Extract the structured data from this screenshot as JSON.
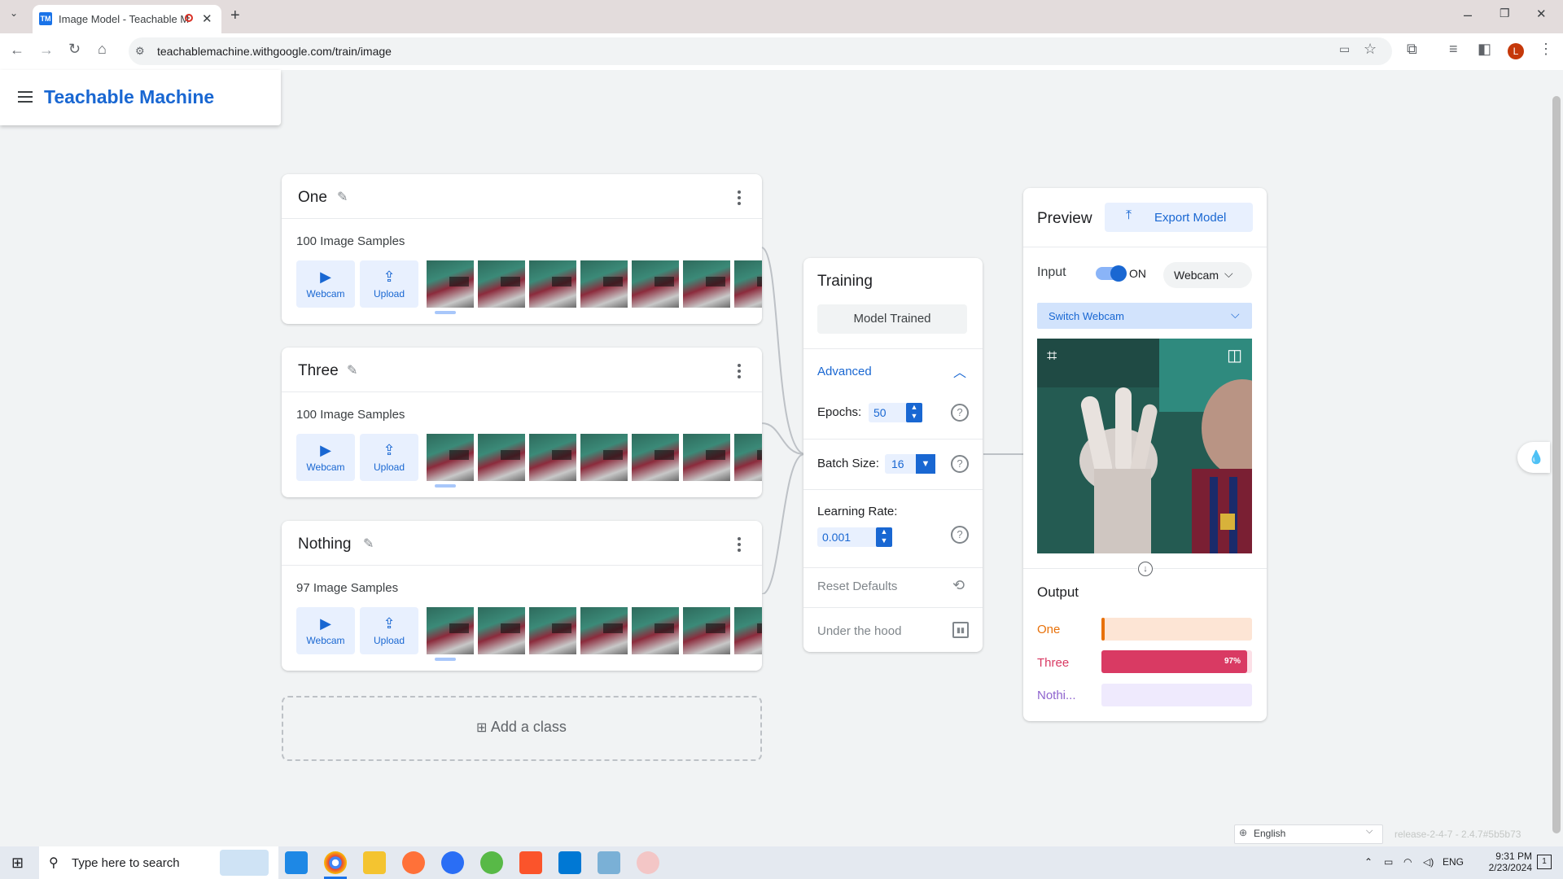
{
  "browser": {
    "tab_title": "Image Model - Teachable M",
    "tab_favicon": "TM",
    "url": "teachablemachine.withgoogle.com/train/image",
    "profile_initial": "L"
  },
  "app": {
    "brand": "Teachable Machine"
  },
  "classes": [
    {
      "name": "One",
      "samples": "100 Image Samples",
      "webcam_label": "Webcam",
      "upload_label": "Upload"
    },
    {
      "name": "Three",
      "samples": "100 Image Samples",
      "webcam_label": "Webcam",
      "upload_label": "Upload"
    },
    {
      "name": "Nothing",
      "samples": "97 Image Samples",
      "webcam_label": "Webcam",
      "upload_label": "Upload"
    }
  ],
  "add_class": {
    "label": "Add a class"
  },
  "training": {
    "title": "Training",
    "status_button": "Model Trained",
    "advanced_label": "Advanced",
    "epochs_label": "Epochs:",
    "epochs_value": "50",
    "batch_label": "Batch Size:",
    "batch_value": "16",
    "lr_label": "Learning Rate:",
    "lr_value": "0.001",
    "reset_label": "Reset Defaults",
    "hood_label": "Under the hood"
  },
  "preview": {
    "title": "Preview",
    "export_label": "Export Model",
    "input_label": "Input",
    "toggle_state": "ON",
    "source_dropdown": "Webcam",
    "switch_dropdown": "Switch Webcam",
    "output_title": "Output",
    "outputs": [
      {
        "label": "One",
        "value": 0.02,
        "color": "#e8710a",
        "track": "#fde5d5"
      },
      {
        "label": "Three",
        "value": 0.97,
        "color": "#d93a63",
        "track": "#fce0e7",
        "text": "97%"
      },
      {
        "label": "Nothi...",
        "value": 0.0,
        "color": "#8e63ce",
        "track": "#efeafd"
      }
    ]
  },
  "footer": {
    "language": "English",
    "release": "release-2-4-7 - 2.4.7#5b5b73"
  },
  "taskbar": {
    "search_placeholder": "Type here to search",
    "lang": "ENG",
    "time": "9:31 PM",
    "date": "2/23/2024",
    "notif_count": "1"
  }
}
